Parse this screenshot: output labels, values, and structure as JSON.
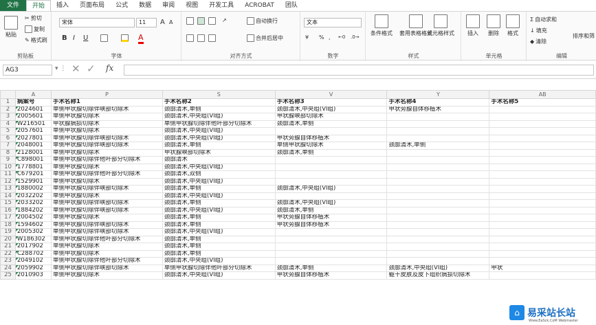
{
  "tabs": [
    "文件",
    "开始",
    "插入",
    "页面布局",
    "公式",
    "数据",
    "审阅",
    "视图",
    "开发工具",
    "ACROBAT",
    "团队"
  ],
  "active_tab": "开始",
  "ribbon": {
    "clipboard": {
      "label": "剪贴板",
      "paste": "粘贴",
      "cut": "剪切",
      "copy": "复制",
      "format_painter": "格式刷"
    },
    "font": {
      "label": "字体",
      "name": "宋体",
      "size": "11",
      "grow": "A",
      "shrink": "A",
      "bold": "B",
      "italic": "I",
      "underline": "U"
    },
    "alignment": {
      "label": "对齐方式",
      "wrap": "自动换行",
      "merge": "合并后居中"
    },
    "number": {
      "label": "数字",
      "format": "文本",
      "percent": "%",
      "comma": ","
    },
    "styles": {
      "label": "样式",
      "conditional": "条件格式",
      "table": "套用表格格式",
      "cell_styles": "单元格样式"
    },
    "cells": {
      "label": "单元格",
      "insert": "插入",
      "delete": "删除",
      "format": "格式"
    },
    "editing": {
      "label": "编辑",
      "autosum": "自动求和",
      "fill": "填充",
      "clear": "清除",
      "sort": "排序和筛"
    }
  },
  "formula_bar": {
    "name_box": "AG3",
    "fx": "fx",
    "value": ""
  },
  "columns": [
    "A",
    "P",
    "S",
    "V",
    "Y",
    "AB"
  ],
  "rows": [
    {
      "n": "1",
      "hdr": true,
      "cells": [
        "病案号",
        "手术名称1",
        "手术名称2",
        "手术名称3",
        "手术名称4",
        "手术名称5"
      ]
    },
    {
      "n": "2",
      "cells": [
        "2024601",
        "单侧甲状腺切除伴峡部切除术",
        "颈廓清术,单侧",
        "颈廓清术,中央组(VI组)",
        "甲状旁腺自体移植术",
        ""
      ]
    },
    {
      "n": "3",
      "cells": [
        "2005601",
        "单侧甲状腺切除术",
        "颈廓清术,中央组(VI组)",
        "甲状腺峡部切除术",
        "",
        ""
      ]
    },
    {
      "n": "4",
      "cells": [
        "W216501",
        "甲状腺病损切除术",
        "单侧甲状腺切除伴他叶部分切除术",
        "颈廓清术,单侧",
        "",
        ""
      ]
    },
    {
      "n": "5",
      "cells": [
        "2057601",
        "单侧甲状腺切除术",
        "颈廓清术,中央组(VI组)",
        "",
        "",
        ""
      ]
    },
    {
      "n": "6",
      "cells": [
        "2027801",
        "单侧甲状腺切除伴峡部切除术",
        "颈廓清术,中央组(VI组)",
        "甲状旁腺自体移植术",
        "",
        ""
      ]
    },
    {
      "n": "7",
      "cells": [
        "2048001",
        "单侧甲状腺切除伴峡部切除术",
        "颈廓清术,单侧",
        "单侧甲状腺切除术",
        "颈廓清术,单侧",
        ""
      ]
    },
    {
      "n": "8",
      "cells": [
        "2128001",
        "单侧甲状腺切除术",
        "甲状腺峡部切除术",
        "颈廓清术,单侧",
        "",
        ""
      ]
    },
    {
      "n": "9",
      "cells": [
        "C898001",
        "单侧甲状腺切除伴他叶部分切除术",
        "颈廓清术",
        "",
        "",
        ""
      ]
    },
    {
      "n": "10",
      "cells": [
        "1778801",
        "单侧甲状腺切除术",
        "颈廓清术,中央组(VI组)",
        "",
        "",
        ""
      ]
    },
    {
      "n": "11",
      "cells": [
        "C679201",
        "单侧甲状腺切除伴他叶部分切除术",
        "颈廓清术,双侧",
        "",
        "",
        ""
      ]
    },
    {
      "n": "12",
      "cells": [
        "1529901",
        "单侧甲状腺切除术",
        "颈廓清术,中央组(VI组)",
        "",
        "",
        ""
      ]
    },
    {
      "n": "13",
      "cells": [
        "1880002",
        "单侧甲状腺切除伴峡部切除术",
        "颈廓清术,单侧",
        "颈廓清术,中央组(VI组)",
        "",
        ""
      ]
    },
    {
      "n": "14",
      "cells": [
        "2032202",
        "单侧甲状腺切除术",
        "颈廓清术,中央组(VI组)",
        "",
        "",
        ""
      ]
    },
    {
      "n": "15",
      "cells": [
        "2033202",
        "单侧甲状腺切除伴峡部切除术",
        "颈廓清术,单侧",
        "颈廓清术,中央组(VI组)",
        "",
        ""
      ]
    },
    {
      "n": "16",
      "cells": [
        "1884202",
        "单侧甲状腺切除伴峡部切除术",
        "颈廓清术,中央组(VI组)",
        "颈廓清术,单侧",
        "",
        ""
      ]
    },
    {
      "n": "17",
      "cells": [
        "2004502",
        "单侧甲状腺切除术",
        "颈廓清术,单侧",
        "甲状旁腺自体移植术",
        "",
        ""
      ]
    },
    {
      "n": "18",
      "cells": [
        "1594602",
        "单侧甲状腺切除伴峡部切除术",
        "颈廓清术,单侧",
        "甲状旁腺自体移植术",
        "",
        ""
      ]
    },
    {
      "n": "19",
      "cells": [
        "2005302",
        "单侧甲状腺切除伴峡部切除术",
        "颈廓清术,中央组(VI组)",
        "",
        "",
        ""
      ]
    },
    {
      "n": "20",
      "cells": [
        "W186302",
        "单侧甲状腺切除伴他叶部分切除术",
        "颈廓清术,单侧",
        "",
        "",
        ""
      ]
    },
    {
      "n": "21",
      "cells": [
        "2017902",
        "单侧甲状腺切除术",
        "颈廓清术,单侧",
        "",
        "",
        ""
      ]
    },
    {
      "n": "22",
      "cells": [
        "C288702",
        "单侧甲状腺切除术",
        "颈廓清术,单侧",
        "",
        "",
        ""
      ]
    },
    {
      "n": "23",
      "cells": [
        "2049102",
        "单侧甲状腺切除伴他叶部分切除术",
        "颈廓清术,中央组(VI组)",
        "",
        "",
        ""
      ]
    },
    {
      "n": "24",
      "cells": [
        "2059902",
        "单侧甲状腺切除伴峡部切除术",
        "单侧甲状腺切除伴他叶部分切除术",
        "颈廓清术,单侧",
        "颈廓清术,中央组(VI组)",
        "甲状"
      ]
    },
    {
      "n": "25",
      "cells": [
        "2010903",
        "单侧甲状腺切除术",
        "颈廓清术,中央组(VI组)",
        "甲状旁腺自体移植术",
        "躯干皮肤及皮下组织病损切除术",
        ""
      ]
    }
  ],
  "watermark": {
    "brand": "易采站长站",
    "sub": "Www.EaSck.CoM Webmaster"
  },
  "colors": {
    "accent": "#217346"
  }
}
